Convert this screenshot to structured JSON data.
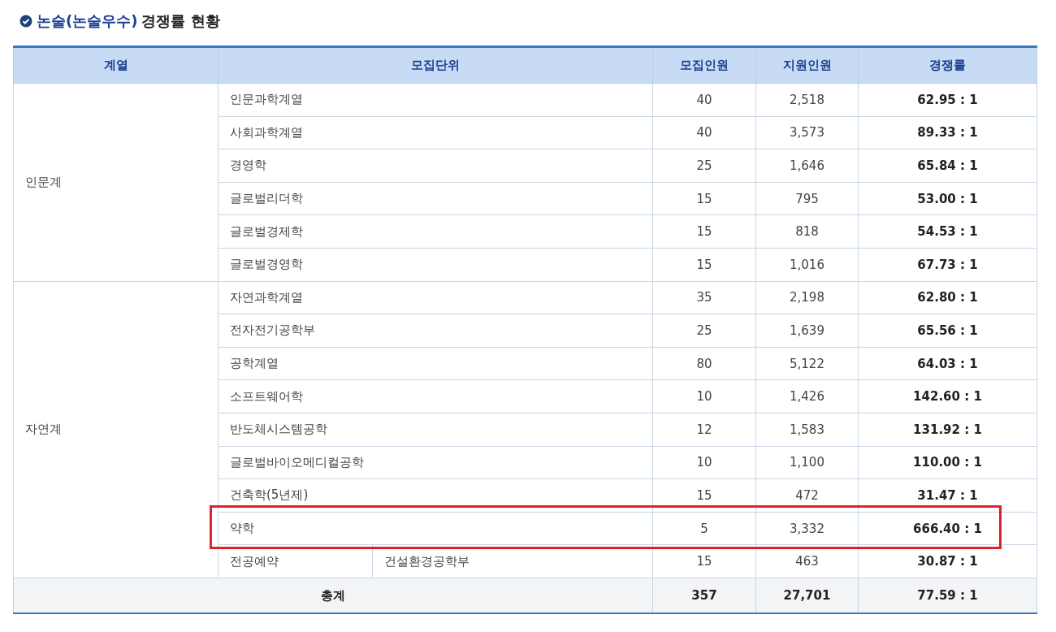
{
  "title": {
    "highlight": "논술(논술우수)",
    "rest": "경쟁률 현황"
  },
  "columns": [
    "계열",
    "모집단위",
    "모집인원",
    "지원인원",
    "경쟁률"
  ],
  "groups": [
    {
      "name": "인문계",
      "rows": [
        {
          "unit": "인문과학계열",
          "quota": "40",
          "applicants": "2,518",
          "ratio": "62.95 : 1",
          "highlighted": false
        },
        {
          "unit": "사회과학계열",
          "quota": "40",
          "applicants": "3,573",
          "ratio": "89.33 : 1",
          "highlighted": false
        },
        {
          "unit": "경영학",
          "quota": "25",
          "applicants": "1,646",
          "ratio": "65.84 : 1",
          "highlighted": false
        },
        {
          "unit": "글로벌리더학",
          "quota": "15",
          "applicants": "795",
          "ratio": "53.00 : 1",
          "highlighted": false
        },
        {
          "unit": "글로벌경제학",
          "quota": "15",
          "applicants": "818",
          "ratio": "54.53 : 1",
          "highlighted": false
        },
        {
          "unit": "글로벌경영학",
          "quota": "15",
          "applicants": "1,016",
          "ratio": "67.73 : 1",
          "highlighted": false
        }
      ]
    },
    {
      "name": "자연계",
      "rows": [
        {
          "unit": "자연과학계열",
          "quota": "35",
          "applicants": "2,198",
          "ratio": "62.80 : 1",
          "highlighted": false
        },
        {
          "unit": "전자전기공학부",
          "quota": "25",
          "applicants": "1,639",
          "ratio": "65.56 : 1",
          "highlighted": false
        },
        {
          "unit": "공학계열",
          "quota": "80",
          "applicants": "5,122",
          "ratio": "64.03 : 1",
          "highlighted": false
        },
        {
          "unit": "소프트웨어학",
          "quota": "10",
          "applicants": "1,426",
          "ratio": "142.60 : 1",
          "highlighted": false
        },
        {
          "unit": "반도체시스템공학",
          "quota": "12",
          "applicants": "1,583",
          "ratio": "131.92 : 1",
          "highlighted": false
        },
        {
          "unit": "글로벌바이오메디컬공학",
          "quota": "10",
          "applicants": "1,100",
          "ratio": "110.00 : 1",
          "highlighted": false
        },
        {
          "unit": "건축학(5년제)",
          "quota": "15",
          "applicants": "472",
          "ratio": "31.47 : 1",
          "highlighted": false
        },
        {
          "unit": "약학",
          "quota": "5",
          "applicants": "3,332",
          "ratio": "666.40 : 1",
          "highlighted": true
        },
        {
          "unit": "전공예약",
          "sub_unit": "건설환경공학부",
          "quota": "15",
          "applicants": "463",
          "ratio": "30.87 : 1",
          "highlighted": false
        }
      ]
    }
  ],
  "total": {
    "label": "총계",
    "quota": "357",
    "applicants": "27,701",
    "ratio": "77.59 : 1"
  }
}
